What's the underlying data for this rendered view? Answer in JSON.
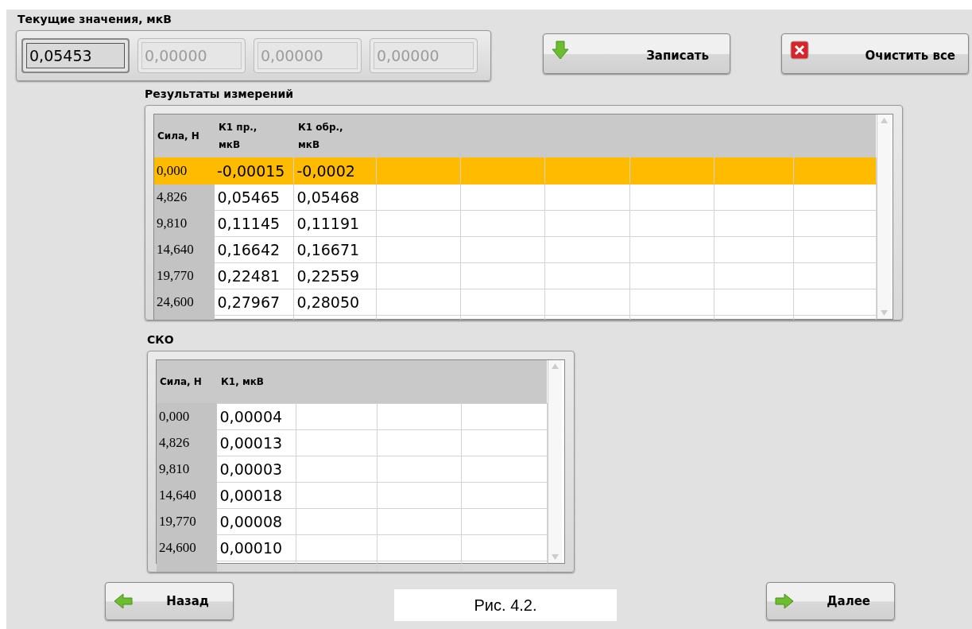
{
  "current_values": {
    "title": "Текущие значения, мкВ",
    "fields": [
      {
        "value": "0,05453",
        "selected": true,
        "disabled": false
      },
      {
        "value": "0,00000",
        "selected": false,
        "disabled": true
      },
      {
        "value": "0,00000",
        "selected": false,
        "disabled": true
      },
      {
        "value": "0,00000",
        "selected": false,
        "disabled": true
      }
    ]
  },
  "top_buttons": [
    {
      "label": "Записать",
      "kind": "save"
    },
    {
      "label": "Очистить все",
      "kind": "clear"
    }
  ],
  "results": {
    "title": "Результаты измерений",
    "columns": [
      "Сила, Н",
      "К1 пр., мкВ",
      "К1 обр., мкВ"
    ],
    "rows": [
      {
        "cells": [
          "0,000",
          "-0,00015",
          "-0,0002"
        ],
        "selected": true
      },
      {
        "cells": [
          "4,826",
          "0,05465",
          "0,05468"
        ],
        "selected": false
      },
      {
        "cells": [
          "9,810",
          "0,11145",
          "0,11191"
        ],
        "selected": false
      },
      {
        "cells": [
          "14,640",
          "0,16642",
          "0,16671"
        ],
        "selected": false
      },
      {
        "cells": [
          "19,770",
          "0,22481",
          "0,22559"
        ],
        "selected": false
      },
      {
        "cells": [
          "24,600",
          "0,27967",
          "0,28050"
        ],
        "selected": false
      }
    ]
  },
  "sko": {
    "title": "СКО",
    "columns": [
      "Сила, Н",
      "К1, мкВ"
    ],
    "rows": [
      {
        "cells": [
          "0,000",
          "0,00004"
        ],
        "selected": false
      },
      {
        "cells": [
          "4,826",
          "0,00013"
        ],
        "selected": false
      },
      {
        "cells": [
          "9,810",
          "0,00003"
        ],
        "selected": false
      },
      {
        "cells": [
          "14,640",
          "0,00018"
        ],
        "selected": false
      },
      {
        "cells": [
          "19,770",
          "0,00008"
        ],
        "selected": false
      },
      {
        "cells": [
          "24,600",
          "0,00010"
        ],
        "selected": false
      }
    ]
  },
  "nav_buttons": [
    {
      "label": "Назад",
      "kind": "back"
    },
    {
      "label": "Далее",
      "kind": "next"
    }
  ],
  "caption": "Рис. 4.2."
}
